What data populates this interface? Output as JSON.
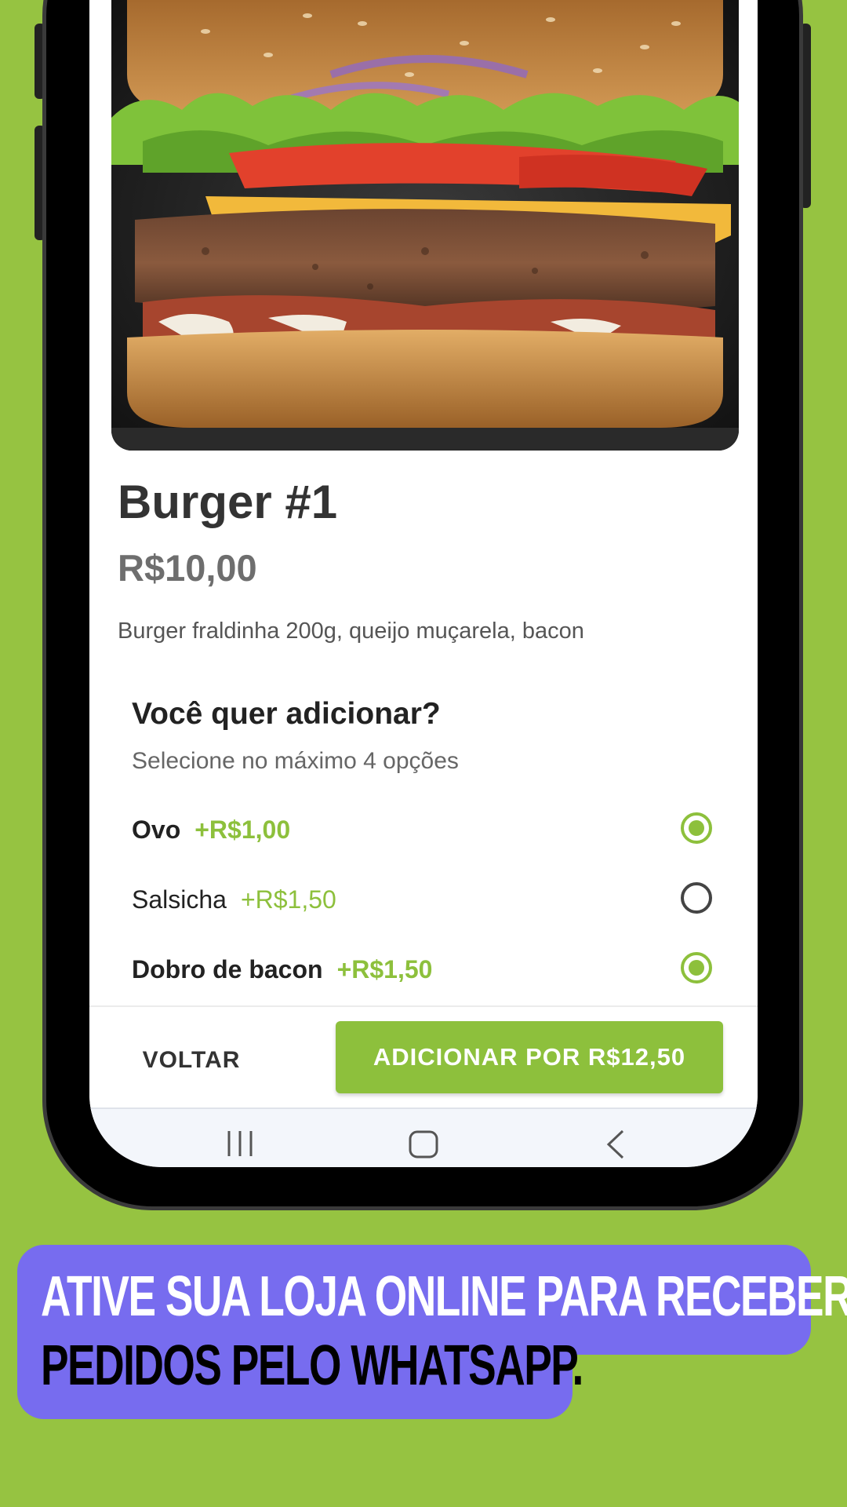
{
  "product": {
    "image_alt": "burger-photo",
    "title": "Burger #1",
    "price": "R$10,00",
    "description": "Burger fraldinha 200g, queijo muçarela, bacon"
  },
  "addons": {
    "title": "Você quer adicionar?",
    "subtitle": "Selecione no máximo 4 opções",
    "options": [
      {
        "name": "Ovo",
        "price": "+R$1,00",
        "selected": true
      },
      {
        "name": "Salsicha",
        "price": "+R$1,50",
        "selected": false
      },
      {
        "name": "Dobro de bacon",
        "price": "+R$1,50",
        "selected": true
      }
    ]
  },
  "actions": {
    "back_label": "VOLTAR",
    "add_label": "ADICIONAR POR R$12,50"
  },
  "nav": {
    "icons": [
      "recent-apps-icon",
      "home-icon",
      "back-icon"
    ]
  },
  "banner": {
    "line1": "ATIVE SUA LOJA ONLINE PARA RECEBER",
    "line2": "PEDIDOS PELO WHATSAPP."
  },
  "colors": {
    "background": "#96c341",
    "accent": "#8dc03c",
    "banner": "#776cef"
  }
}
